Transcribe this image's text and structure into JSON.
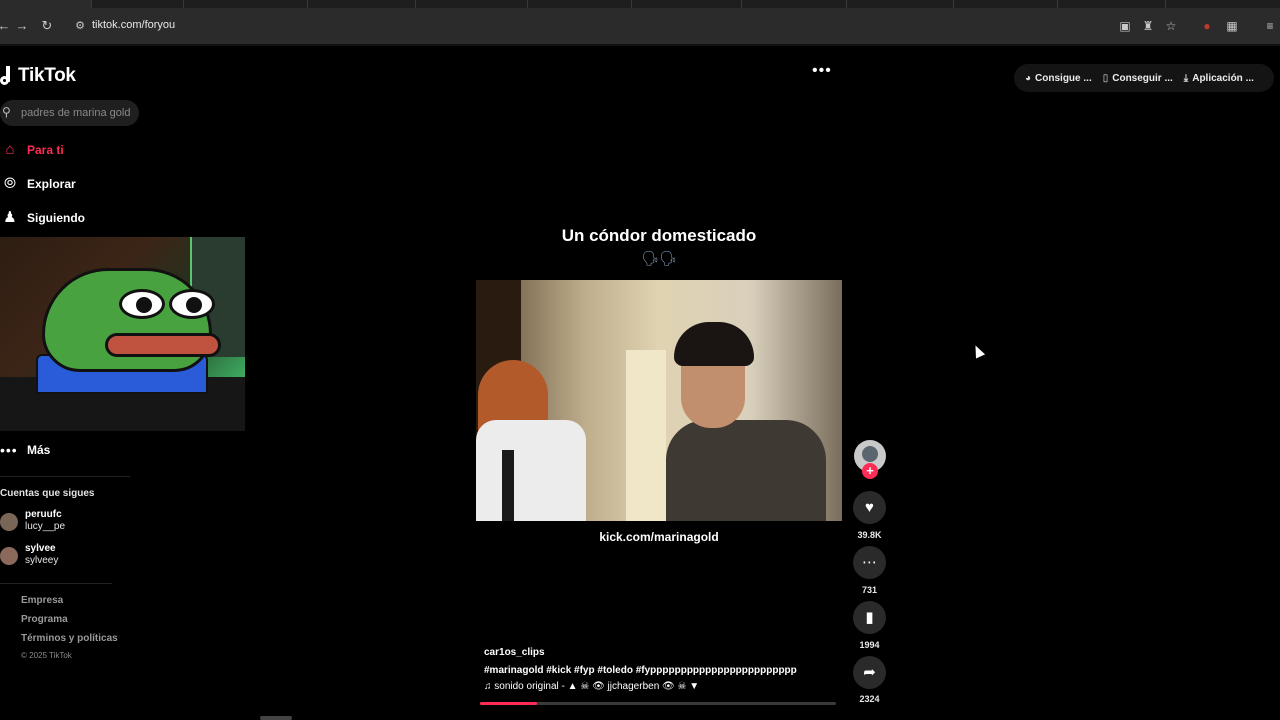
{
  "browser": {
    "url": "tiktok.com/foryou"
  },
  "app": {
    "brand": "TikTok",
    "search_placeholder": "padres de marina gold"
  },
  "sidebar": {
    "nav": [
      {
        "label": "Para ti",
        "icon": "home-icon",
        "active": true
      },
      {
        "label": "Explorar",
        "icon": "compass-icon",
        "active": false
      },
      {
        "label": "Siguiendo",
        "icon": "following-icon",
        "active": false
      }
    ],
    "more_label": "Más",
    "following_title": "Cuentas que sigues",
    "accounts": [
      {
        "username": "peruufc",
        "nickname": "lucy__pe"
      },
      {
        "username": "sylvee",
        "nickname": "sylveey"
      }
    ],
    "footer_links": [
      "Empresa",
      "Programa",
      "Términos y políticas"
    ],
    "copyright": "© 2025 TikTok"
  },
  "top_actions": [
    {
      "label": "Consigue ...",
      "icon": "coin-icon"
    },
    {
      "label": "Conseguir ...",
      "icon": "phone-icon"
    },
    {
      "label": "Aplicación ...",
      "icon": "download-icon"
    }
  ],
  "video": {
    "title": "Un cóndor domesticado",
    "emoji": "🗣🗣",
    "caption": "kick.com/marinagold",
    "author": "car1os_clips",
    "hashtags": "#marinagold  #kick  #fyp  #toledo #fypppppppppppppppppppppppp",
    "sound": "♫  sonido original -  ▲ ☠ 👁 jjchagerben 👁 ☠ ▼",
    "progress": 0.16
  },
  "actions": {
    "likes": "39.8K",
    "comments": "731",
    "saves": "1994",
    "shares": "2324"
  },
  "colors": {
    "accent": "#fe2c55",
    "background": "#000000"
  }
}
